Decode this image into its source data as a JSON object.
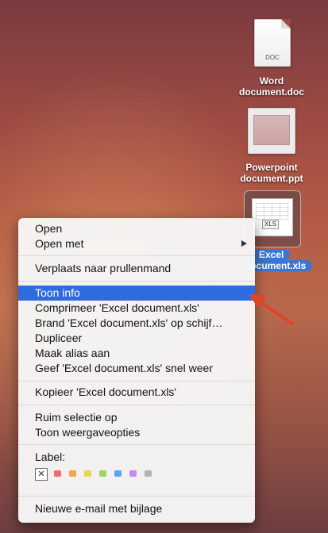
{
  "desktop": {
    "icons": [
      {
        "label_line1": "Word",
        "label_line2": "document.doc",
        "badge": "DOC"
      },
      {
        "label_line1": "Powerpoint",
        "label_line2": "document.ppt"
      },
      {
        "label_line1": "Excel",
        "label_line2": "document.xls",
        "badge": "XLS",
        "selected": true
      }
    ]
  },
  "context_menu": {
    "open": "Open",
    "open_with": "Open met",
    "trash": "Verplaats naar prullenmand",
    "get_info": "Toon info",
    "compress": "Comprimeer 'Excel document.xls'",
    "burn": "Brand 'Excel document.xls' op schijf…",
    "duplicate": "Dupliceer",
    "make_alias": "Maak alias aan",
    "quick_look": "Geef 'Excel document.xls' snel weer",
    "copy": "Kopieer 'Excel document.xls'",
    "clean_up": "Ruim selectie op",
    "view_options": "Toon weergaveopties",
    "label_heading": "Label:",
    "label_clear": "✕",
    "label_colors": [
      "#f26b6b",
      "#f2a54a",
      "#f0d54a",
      "#9ed85a",
      "#5aa3f0",
      "#c38bf0",
      "#b4b4b4"
    ],
    "new_email": "Nieuwe e-mail met bijlage",
    "highlighted_item": "get_info"
  },
  "colors": {
    "highlight": "#2f6be0",
    "annotation_arrow": "#e0442b"
  }
}
